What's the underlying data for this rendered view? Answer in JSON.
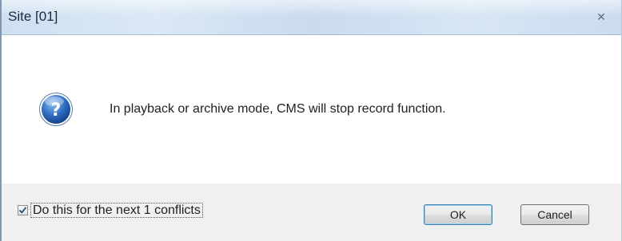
{
  "window": {
    "title": "Site [01]",
    "close_glyph": "✕"
  },
  "dialog": {
    "icon": "question-icon",
    "message": "In playback or archive mode, CMS will stop record function."
  },
  "footer": {
    "checkbox_label": "Do this for the next 1 conflicts",
    "checkbox_checked": true,
    "ok_label": "OK",
    "cancel_label": "Cancel"
  },
  "colors": {
    "titlebar": "#d3e3f3",
    "footer": "#f0f0f0",
    "icon_blue": "#2f6fc4"
  }
}
